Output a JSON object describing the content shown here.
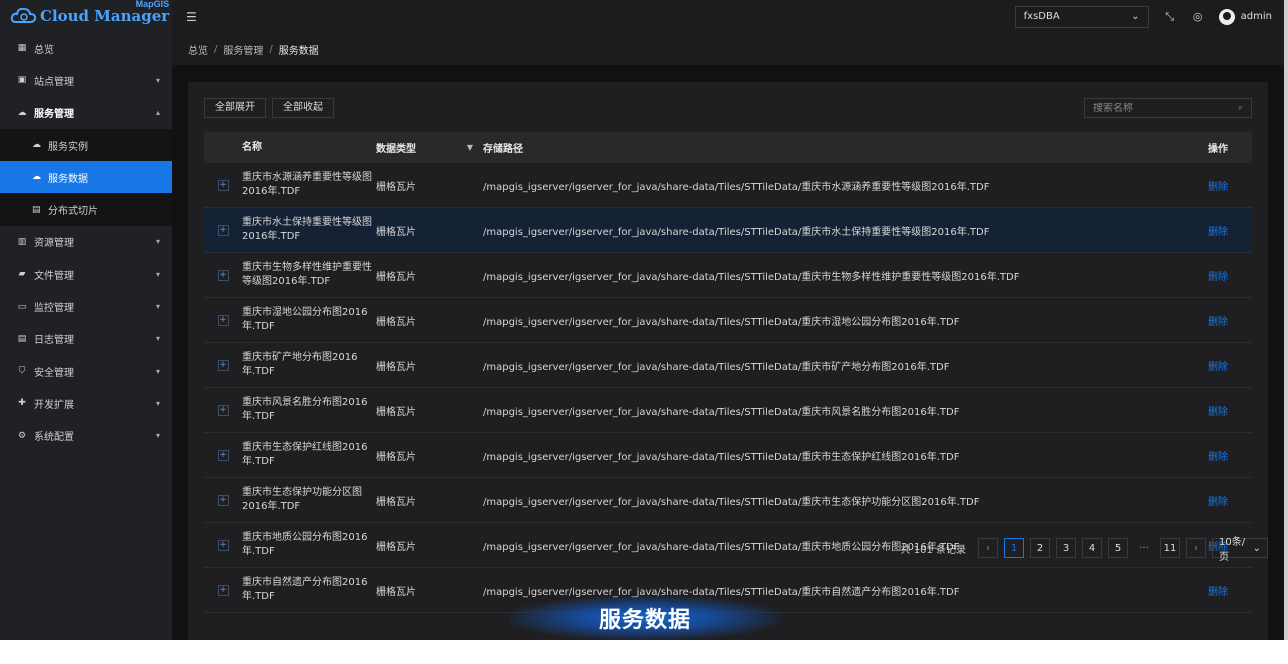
{
  "brand": {
    "main": "Cloud Manager",
    "sup": "MapGIS"
  },
  "sidebar": {
    "items": [
      {
        "label": "总览",
        "icon": "dashboard-icon",
        "chev": ""
      },
      {
        "label": "站点管理",
        "icon": "site-icon",
        "chev": "⌄"
      },
      {
        "label": "服务管理",
        "icon": "service-icon",
        "chev": "⌃"
      },
      {
        "label": "资源管理",
        "icon": "resource-icon",
        "chev": "⌄"
      },
      {
        "label": "文件管理",
        "icon": "folder-icon",
        "chev": "⌄"
      },
      {
        "label": "监控管理",
        "icon": "monitor-icon",
        "chev": "⌄"
      },
      {
        "label": "日志管理",
        "icon": "log-icon",
        "chev": "⌄"
      },
      {
        "label": "安全管理",
        "icon": "shield-icon",
        "chev": "⌄"
      },
      {
        "label": "开发扩展",
        "icon": "extension-icon",
        "chev": "⌄"
      },
      {
        "label": "系统配置",
        "icon": "gear-icon",
        "chev": "⌄"
      }
    ],
    "submenu": [
      {
        "label": "服务实例",
        "icon": "cloud-icon"
      },
      {
        "label": "服务数据",
        "icon": "cloud-data-icon"
      },
      {
        "label": "分布式切片",
        "icon": "slice-icon"
      }
    ]
  },
  "header": {
    "db_select": "fxsDBA",
    "user": "admin"
  },
  "breadcrumb": [
    "总览",
    "服务管理",
    "服务数据"
  ],
  "toolbar": {
    "expand_all": "全部展开",
    "collapse_all": "全部收起"
  },
  "search": {
    "placeholder": "搜索名称"
  },
  "table": {
    "columns": {
      "name": "名称",
      "type": "数据类型",
      "path": "存储路径",
      "op": "操作"
    },
    "rows": [
      {
        "name": "重庆市水源涵养重要性等级图2016年.TDF",
        "type": "栅格瓦片",
        "path": "/mapgis_igserver/igserver_for_java/share-data/Tiles/STTileData/重庆市水源涵养重要性等级图2016年.TDF",
        "op": "删除"
      },
      {
        "name": "重庆市水土保持重要性等级图2016年.TDF",
        "type": "栅格瓦片",
        "path": "/mapgis_igserver/igserver_for_java/share-data/Tiles/STTileData/重庆市水土保持重要性等级图2016年.TDF",
        "op": "删除"
      },
      {
        "name": "重庆市生物多样性维护重要性等级图2016年.TDF",
        "type": "栅格瓦片",
        "path": "/mapgis_igserver/igserver_for_java/share-data/Tiles/STTileData/重庆市生物多样性维护重要性等级图2016年.TDF",
        "op": "删除"
      },
      {
        "name": "重庆市湿地公园分布图2016年.TDF",
        "type": "栅格瓦片",
        "path": "/mapgis_igserver/igserver_for_java/share-data/Tiles/STTileData/重庆市湿地公园分布图2016年.TDF",
        "op": "删除"
      },
      {
        "name": "重庆市矿产地分布图2016年.TDF",
        "type": "栅格瓦片",
        "path": "/mapgis_igserver/igserver_for_java/share-data/Tiles/STTileData/重庆市矿产地分布图2016年.TDF",
        "op": "删除"
      },
      {
        "name": "重庆市风景名胜分布图2016年.TDF",
        "type": "栅格瓦片",
        "path": "/mapgis_igserver/igserver_for_java/share-data/Tiles/STTileData/重庆市风景名胜分布图2016年.TDF",
        "op": "删除"
      },
      {
        "name": "重庆市生态保护红线图2016年.TDF",
        "type": "栅格瓦片",
        "path": "/mapgis_igserver/igserver_for_java/share-data/Tiles/STTileData/重庆市生态保护红线图2016年.TDF",
        "op": "删除"
      },
      {
        "name": "重庆市生态保护功能分区图2016年.TDF",
        "type": "栅格瓦片",
        "path": "/mapgis_igserver/igserver_for_java/share-data/Tiles/STTileData/重庆市生态保护功能分区图2016年.TDF",
        "op": "删除"
      },
      {
        "name": "重庆市地质公园分布图2016年.TDF",
        "type": "栅格瓦片",
        "path": "/mapgis_igserver/igserver_for_java/share-data/Tiles/STTileData/重庆市地质公园分布图2016年.TDF",
        "op": "删除"
      },
      {
        "name": "重庆市自然遗产分布图2016年.TDF",
        "type": "栅格瓦片",
        "path": "/mapgis_igserver/igserver_for_java/share-data/Tiles/STTileData/重庆市自然遗产分布图2016年.TDF",
        "op": "删除"
      }
    ]
  },
  "pagination": {
    "total": "共 101 条记录",
    "prev": "‹",
    "pages": [
      "1",
      "2",
      "3",
      "4",
      "5"
    ],
    "ellipsis": "···",
    "last": "11",
    "next": "›",
    "page_size": "10条/页"
  },
  "banner": {
    "text": "服务数据"
  },
  "colors": {
    "accent": "#1677e5",
    "sidebar_bg": "#202124",
    "card_bg": "#1f1f21"
  }
}
